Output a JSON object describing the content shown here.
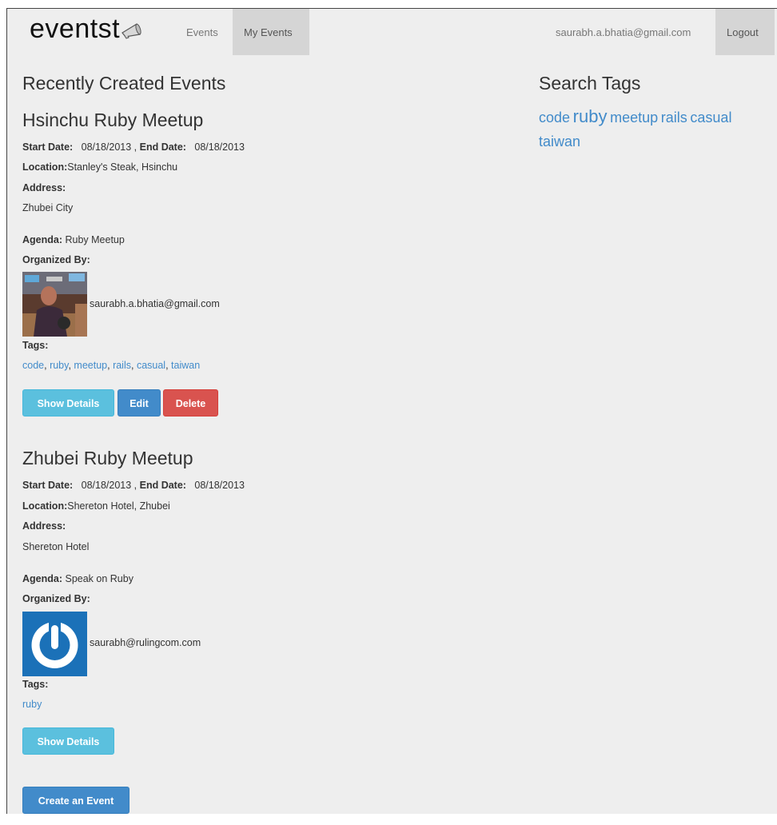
{
  "nav": {
    "brand": "eventst",
    "events": "Events",
    "my_events": "My Events",
    "user_email": "saurabh.a.bhatia@gmail.com",
    "logout": "Logout"
  },
  "main": {
    "heading": "Recently Created Events",
    "labels": {
      "start_date": "Start Date:",
      "end_date": "End Date:",
      "location": "Location:",
      "address": "Address:",
      "agenda": "Agenda:",
      "organized_by": "Organized By:",
      "tags": "Tags:"
    },
    "events": [
      {
        "title": "Hsinchu Ruby Meetup",
        "start_date": "08/18/2013",
        "end_date": "08/18/2013",
        "location": "Stanley's Steak, Hsinchu",
        "address": "Zhubei City",
        "agenda": "Ruby Meetup",
        "organizer_email": "saurabh.a.bhatia@gmail.com",
        "tags": [
          "code",
          "ruby",
          "meetup",
          "rails",
          "casual",
          "taiwan"
        ],
        "buttons": {
          "show": "Show Details",
          "edit": "Edit",
          "delete": "Delete"
        }
      },
      {
        "title": "Zhubei Ruby Meetup",
        "start_date": "08/18/2013",
        "end_date": "08/18/2013",
        "location": "Shereton Hotel, Zhubei",
        "address": "Shereton Hotel",
        "agenda": "Speak on Ruby",
        "organizer_email": "saurabh@rulingcom.com",
        "tags": [
          "ruby"
        ],
        "buttons": {
          "show": "Show Details"
        }
      }
    ],
    "create_button": "Create an Event"
  },
  "sidebar": {
    "heading": "Search Tags",
    "tags": [
      "code",
      "ruby",
      "meetup",
      "rails",
      "casual",
      "taiwan"
    ]
  },
  "colors": {
    "background": "#eeeeee",
    "link": "#428bca",
    "info": "#5bc0de",
    "primary": "#428bca",
    "danger": "#d9534f"
  }
}
